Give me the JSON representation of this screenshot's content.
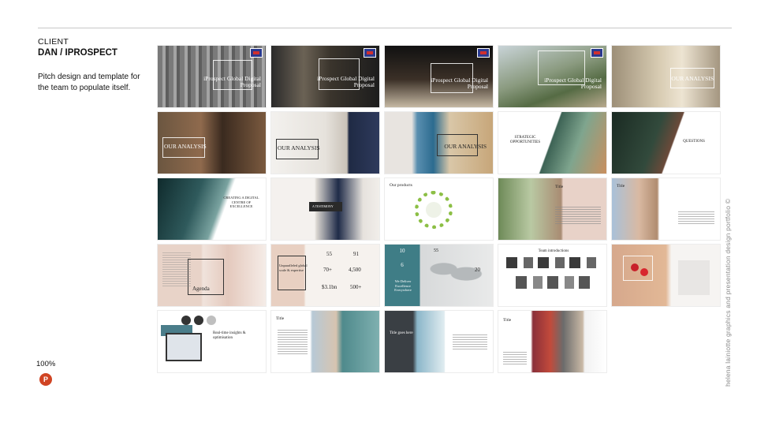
{
  "header": {
    "client_label": "CLIENT",
    "client_name": "DAN / IPROSPECT",
    "description": "Pitch design and template for the team to populate itself."
  },
  "footer": {
    "zoom": "100%",
    "app_icon": "powerpoint-icon",
    "app_icon_letter": "P"
  },
  "vertical_credit": "helena lainiotte graphics and presentation design portfolio ©",
  "slides": [
    {
      "label": "iProspect Global Digital Proposal"
    },
    {
      "label": "iProspect Global Digital Proposal"
    },
    {
      "label": "iProspect Global Digital Proposal"
    },
    {
      "label": "iProspect Global Digital Proposal"
    },
    {
      "label": "OUR ANALYSIS"
    },
    {
      "label": "OUR ANALYSIS"
    },
    {
      "label": "OUR ANALYSIS"
    },
    {
      "label": "OUR ANALYSIS"
    },
    {
      "label": "STRATEGIC OPPORTUNITIES"
    },
    {
      "label": "QUESTIONS"
    },
    {
      "label": "CREATING A DIGITAL CENTRE OF EXCELLENCE"
    },
    {
      "label": "A TESTIMONY"
    },
    {
      "label": "Our products"
    },
    {
      "label": "Title"
    },
    {
      "label": "Title"
    },
    {
      "label": "Agenda"
    },
    {
      "label": "Unparalleled global scale & expertise",
      "stats": [
        "55",
        "91",
        "70+",
        "4,500",
        "$3.1bn",
        "500+"
      ]
    },
    {
      "label": "We Deliver Excellence Everywhere",
      "stats": [
        "10",
        "55",
        "6",
        "20"
      ]
    },
    {
      "label": "Team introductions"
    },
    {
      "label": ""
    },
    {
      "label": "Real-time insights & optimisation"
    },
    {
      "label": "Title"
    },
    {
      "label": "Title goes here"
    },
    {
      "label": "Title"
    }
  ]
}
